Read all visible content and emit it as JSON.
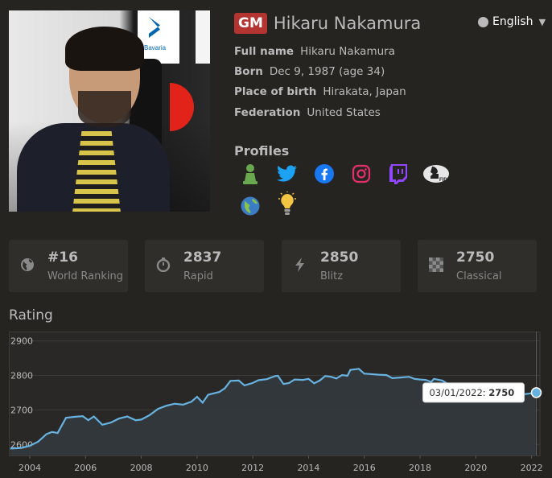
{
  "player": {
    "title_badge": "GM",
    "name": "Hikaru Nakamura",
    "photo_alt": "player-photo"
  },
  "language": {
    "label": "English"
  },
  "info": [
    {
      "key": "Full name",
      "value": "Hikaru Nakamura"
    },
    {
      "key": "Born",
      "value": "Dec 9, 1987 (age 34)"
    },
    {
      "key": "Place of birth",
      "value": "Hirakata, Japan"
    },
    {
      "key": "Federation",
      "value": "United States"
    }
  ],
  "profiles": {
    "heading": "Profiles",
    "icons": [
      "chess-pawn-icon",
      "twitter-icon",
      "facebook-icon",
      "instagram-icon",
      "twitch-icon",
      "fide-icon",
      "globe-icon",
      "lightbulb-icon"
    ]
  },
  "stats": [
    {
      "icon": "globe-icon",
      "value": "#16",
      "label": "World Ranking"
    },
    {
      "icon": "stopwatch-icon",
      "value": "2837",
      "label": "Rapid"
    },
    {
      "icon": "lightning-icon",
      "value": "2850",
      "label": "Blitz"
    },
    {
      "icon": "chessboard-icon",
      "value": "2750",
      "label": "Classical"
    }
  ],
  "rating": {
    "heading": "Rating"
  },
  "colors": {
    "background": "#262421",
    "card": "#302e2b",
    "line": "#67b2e0",
    "gm_badge": "#b33430"
  },
  "chart_data": {
    "type": "area",
    "title": "",
    "xlabel": "",
    "ylabel": "",
    "x_ticks": [
      "2004",
      "2006",
      "2008",
      "2010",
      "2012",
      "2014",
      "2016",
      "2018",
      "2020",
      "2022"
    ],
    "y_ticks": [
      "2900",
      "2800",
      "2700",
      "2600"
    ],
    "xlim": [
      2003.25,
      2022.3
    ],
    "ylim": [
      2568,
      2927
    ],
    "grid": true,
    "tooltip": {
      "date": "03/01/2022",
      "value": "2750"
    },
    "series": [
      {
        "points": [
          [
            2003.3,
            2588
          ],
          [
            2003.7,
            2590
          ],
          [
            2004.0,
            2596
          ],
          [
            2004.3,
            2608
          ],
          [
            2004.6,
            2630
          ],
          [
            2004.8,
            2636
          ],
          [
            2005.0,
            2633
          ],
          [
            2005.3,
            2677
          ],
          [
            2005.6,
            2680
          ],
          [
            2005.9,
            2682
          ],
          [
            2006.1,
            2670
          ],
          [
            2006.3,
            2681
          ],
          [
            2006.6,
            2657
          ],
          [
            2006.9,
            2663
          ],
          [
            2007.2,
            2675
          ],
          [
            2007.5,
            2681
          ],
          [
            2007.8,
            2670
          ],
          [
            2008.0,
            2672
          ],
          [
            2008.3,
            2685
          ],
          [
            2008.6,
            2703
          ],
          [
            2008.9,
            2712
          ],
          [
            2009.2,
            2718
          ],
          [
            2009.5,
            2715
          ],
          [
            2009.8,
            2724
          ],
          [
            2010.0,
            2738
          ],
          [
            2010.2,
            2721
          ],
          [
            2010.4,
            2744
          ],
          [
            2010.6,
            2748
          ],
          [
            2010.8,
            2752
          ],
          [
            2011.0,
            2763
          ],
          [
            2011.2,
            2784
          ],
          [
            2011.5,
            2785
          ],
          [
            2011.7,
            2771
          ],
          [
            2012.0,
            2778
          ],
          [
            2012.2,
            2786
          ],
          [
            2012.5,
            2789
          ],
          [
            2012.8,
            2798
          ],
          [
            2012.9,
            2799
          ],
          [
            2013.1,
            2775
          ],
          [
            2013.3,
            2778
          ],
          [
            2013.5,
            2788
          ],
          [
            2013.8,
            2787
          ],
          [
            2014.0,
            2790
          ],
          [
            2014.2,
            2777
          ],
          [
            2014.4,
            2785
          ],
          [
            2014.6,
            2798
          ],
          [
            2014.8,
            2796
          ],
          [
            2015.0,
            2791
          ],
          [
            2015.2,
            2801
          ],
          [
            2015.4,
            2799
          ],
          [
            2015.5,
            2816
          ],
          [
            2015.7,
            2818
          ],
          [
            2015.8,
            2819
          ],
          [
            2016.0,
            2805
          ],
          [
            2016.2,
            2804
          ],
          [
            2016.5,
            2802
          ],
          [
            2016.8,
            2801
          ],
          [
            2017.0,
            2792
          ],
          [
            2017.3,
            2794
          ],
          [
            2017.6,
            2796
          ],
          [
            2017.8,
            2790
          ],
          [
            2018.0,
            2788
          ],
          [
            2018.2,
            2787
          ],
          [
            2018.4,
            2781
          ],
          [
            2018.5,
            2790
          ],
          [
            2018.8,
            2785
          ],
          [
            2019.0,
            2775
          ],
          [
            2019.5,
            2762
          ],
          [
            2020.0,
            2745
          ],
          [
            2020.6,
            2738
          ],
          [
            2021.0,
            2736
          ],
          [
            2021.5,
            2743
          ],
          [
            2021.9,
            2747
          ],
          [
            2022.17,
            2750
          ]
        ]
      }
    ]
  }
}
